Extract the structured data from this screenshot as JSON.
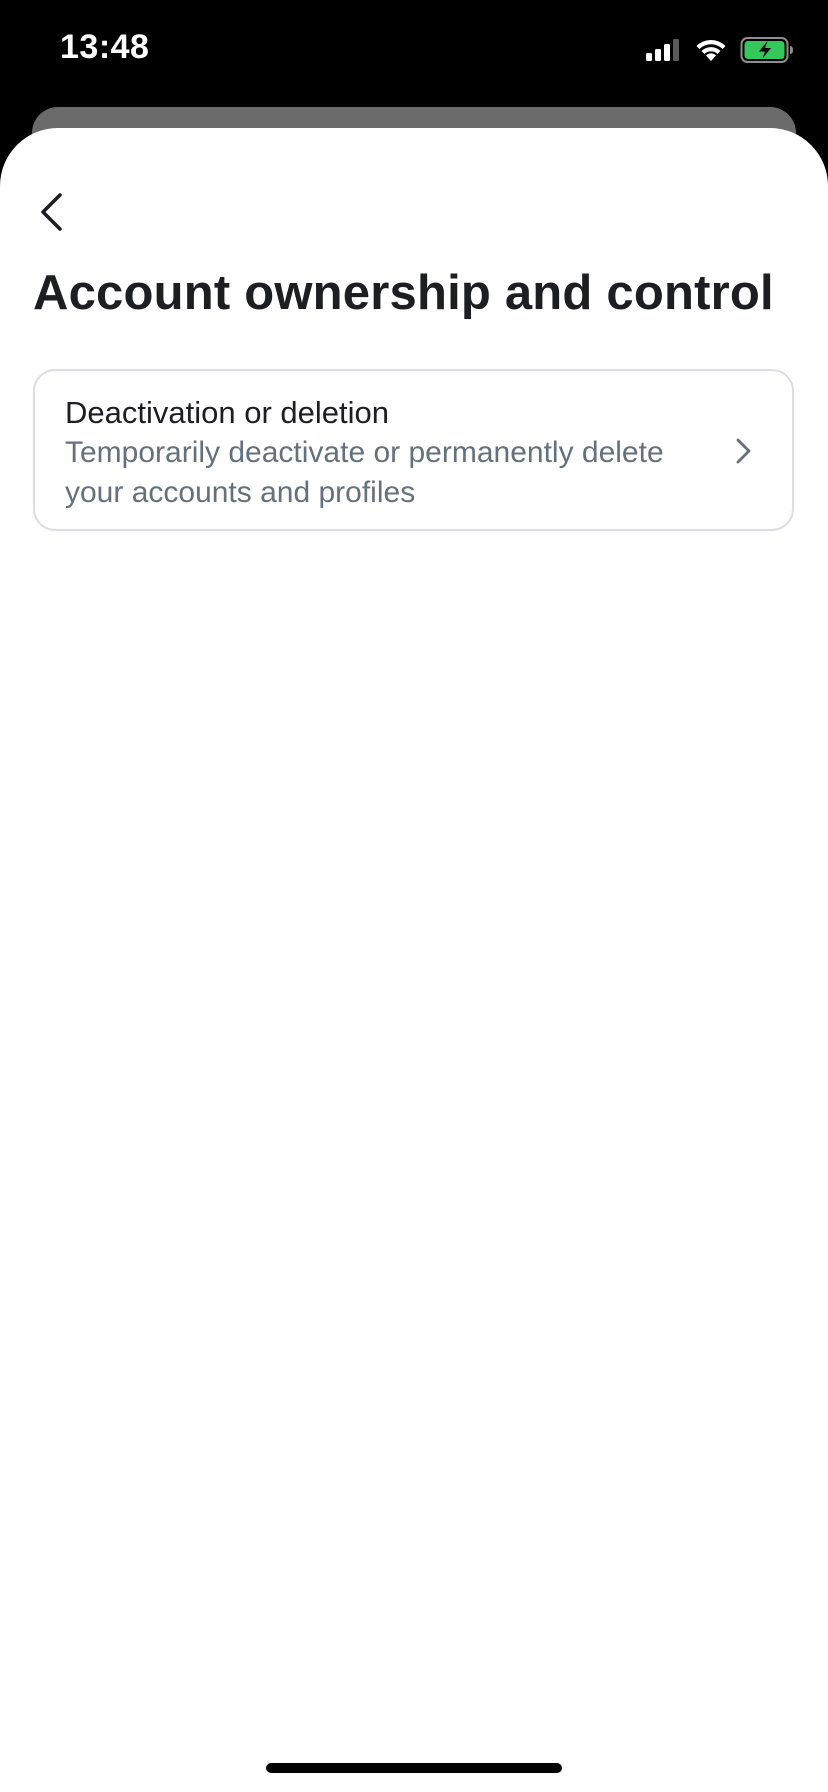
{
  "status_bar": {
    "time": "13:48",
    "icons": [
      "cellular-signal-icon",
      "wifi-icon",
      "battery-charging-icon"
    ],
    "battery_color": "#34c759"
  },
  "header": {
    "back_icon": "chevron-left-icon",
    "title": "Account ownership and control"
  },
  "options": [
    {
      "title": "Deactivation or deletion",
      "description": "Temporarily deactivate or permanently delete your accounts and profiles",
      "icon": "chevron-right-icon"
    }
  ],
  "colors": {
    "title_text": "#1c1e21",
    "secondary_text": "#65707d",
    "card_border": "#dadde1"
  }
}
